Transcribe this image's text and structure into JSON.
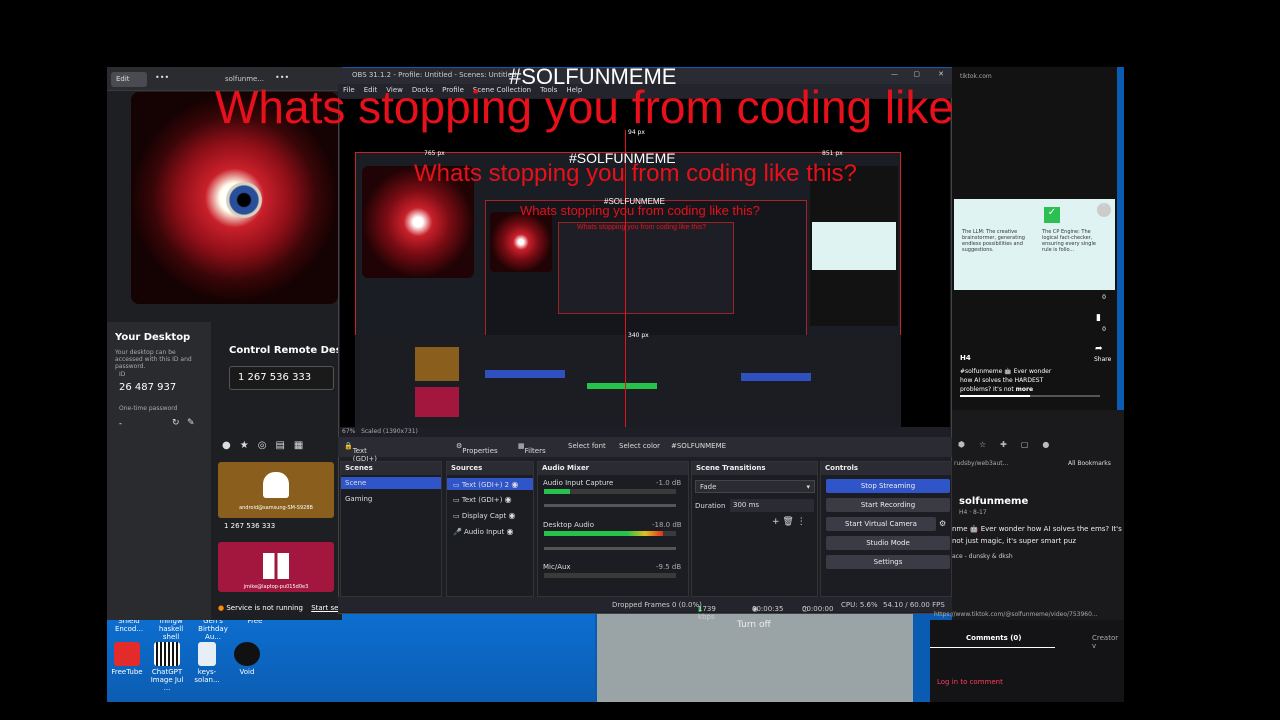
{
  "overlay": {
    "title": "Whats stopping you from coding like this?",
    "hashtag": "#SOLFUNMEME"
  },
  "remote_app": {
    "edit_label": "Edit",
    "top_tab": "solfunme...",
    "your_desktop_heading": "Your Desktop",
    "your_desktop_desc": "Your desktop can be accessed with this ID and password.",
    "id_label": "ID",
    "id_value": "26 487 937",
    "otp_label": "One-time password",
    "otp_value": "-",
    "control_heading": "Control Remote Desktop",
    "remote_id_value": "1 267 536 333",
    "device1_name": "android@samsung-SM-S928B",
    "device1_id": "1 267 536 333",
    "device2_name": "jmike@laptop-pu015d0e3",
    "service_status": "Service is not running",
    "start_service": "Start serv"
  },
  "desktop": {
    "icons_top": [
      "Shield Encod...",
      "mingw haskell shell",
      "Gen's Birthday Au...",
      "Free"
    ],
    "icons": [
      "FreeTube",
      "ChatGPT Image Jul ...",
      "keys-solan...",
      "Void"
    ],
    "turn_off": "Turn off"
  },
  "obs": {
    "title": "OBS 31.1.2 - Profile: Untitled - Scenes: Untitled",
    "menu": [
      "File",
      "Edit",
      "View",
      "Docks",
      "Profile",
      "Scene Collection",
      "Tools",
      "Help"
    ],
    "preview_top_px": "765 px",
    "preview_center_px": "94 px",
    "preview_right_px": "851 px",
    "preview_bottom_px": "340 px",
    "zoom": "67%",
    "scaled": "Scaled (1390x731)",
    "source_selected": "Text (GDI+) 2",
    "toolbar": {
      "properties": "Properties",
      "filters": "Filters",
      "select_font": "Select font",
      "select_color": "Select color",
      "text_value": "#SOLFUNMEME"
    },
    "scenes": {
      "header": "Scenes",
      "items": [
        "Scene",
        "Gaming"
      ]
    },
    "sources": {
      "header": "Sources",
      "items": [
        "Text (GDI+) 2",
        "Text (GDI+)",
        "Display Capt",
        "Audio Input"
      ]
    },
    "mixer": {
      "header": "Audio Mixer",
      "channels": [
        {
          "name": "Audio Input Capture",
          "db": "-1.0 dB",
          "level": 0.2
        },
        {
          "name": "Desktop Audio",
          "db": "-18.0 dB",
          "level": 0.9
        },
        {
          "name": "Mic/Aux",
          "db": "-9.5 dB",
          "level": 0.0
        }
      ]
    },
    "transitions": {
      "header": "Scene Transitions",
      "type": "Fade",
      "duration_label": "Duration",
      "duration_value": "300 ms"
    },
    "controls": {
      "header": "Controls",
      "stop_streaming": "Stop Streaming",
      "start_recording": "Start Recording",
      "start_virtual_camera": "Start Virtual Camera",
      "studio_mode": "Studio Mode",
      "settings": "Settings"
    },
    "status": {
      "dropped": "Dropped Frames 0 (0.0%)",
      "bitrate": "1739 kbps",
      "live_time": "00:00:35",
      "rec_time": "00:00:00",
      "cpu": "CPU: 5.6%",
      "fps": "54.10 / 60.00 FPS"
    }
  },
  "tiktok": {
    "tab_title": "tiktok.com",
    "card_left": "The LLM: The creative brainstormer, generating endless possibilities and suggestions.",
    "card_right": "The CP Engine: The logical fact-checker, ensuring every single rule is follo...",
    "counts": [
      "0",
      "0",
      "0"
    ],
    "share_label": "Share",
    "user_short": "H4",
    "caption": "#solfunmeme 🤖 Ever wonder how AI solves the HARDEST problems? It's not",
    "more": "more"
  },
  "browser2": {
    "bookmarks": "All Bookmarks",
    "url_fragment": "rudsby/web3aut...",
    "username": "solfunmeme",
    "meta": "H4 · 8-17",
    "caption": "nme 🤖 Ever wonder how AI solves the ems? It's not just magic, it's super smart puz",
    "music": "ace - dunsky & dksh",
    "url": "https://www.tiktok.com/@solfunmeme/video/753960...",
    "comments": "Comments (0)",
    "creator": "Creator v",
    "login": "Log in to comment"
  }
}
